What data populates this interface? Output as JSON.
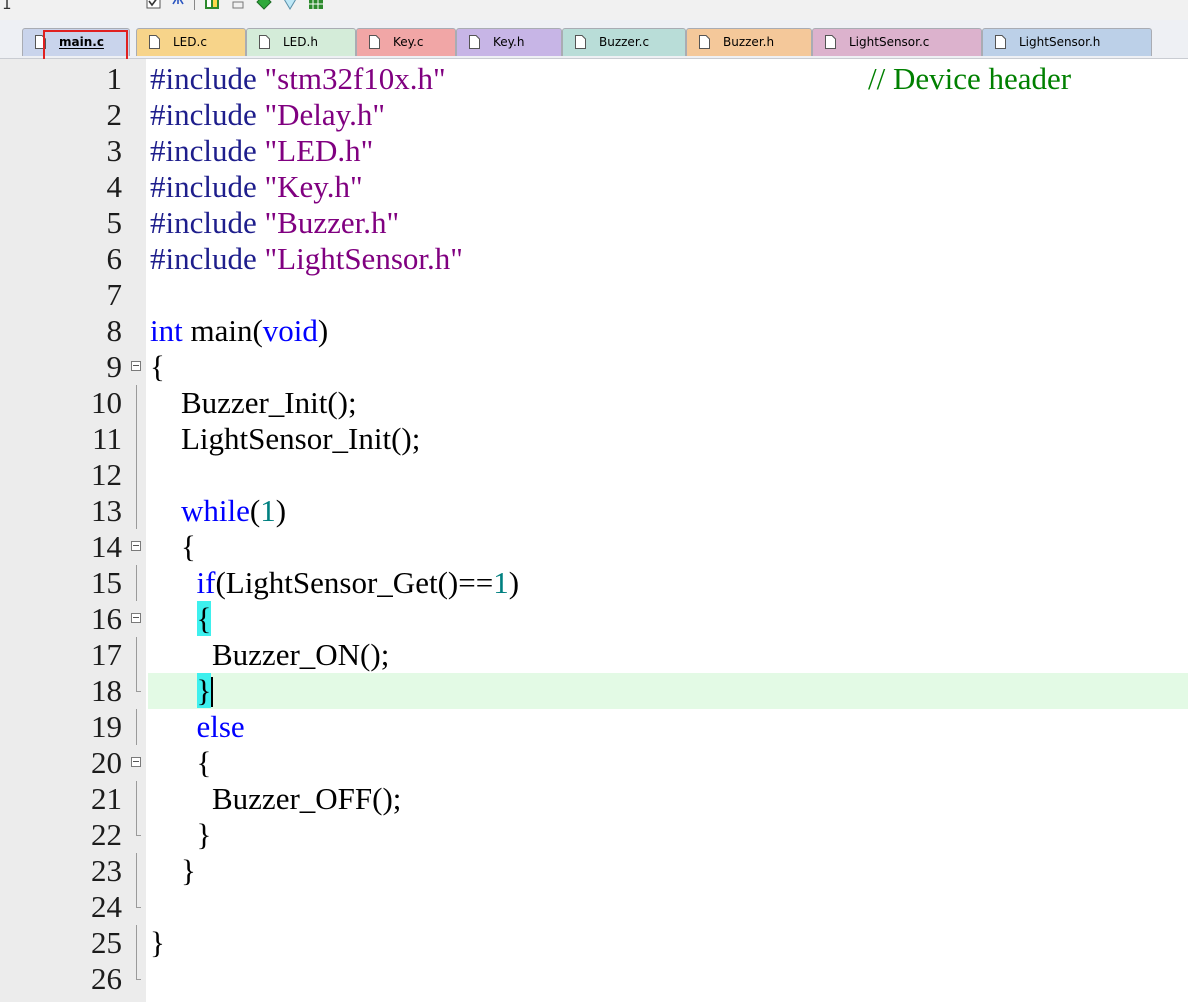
{
  "colors": {
    "keyword": "#0000ff",
    "string": "#800080",
    "comment": "#008000",
    "number": "#008080",
    "current_line_bg": "#e3fae5",
    "brace_match_bg": "#3ef0ee",
    "annotation_box": "#e02020"
  },
  "toolbar": {
    "icons": [
      "checkbox-icon",
      "tree-icon",
      "window-icon",
      "layout-icon",
      "diamond-icon",
      "gem-icon",
      "grid-icon"
    ]
  },
  "tabs": [
    {
      "label": "main.c",
      "color": "#c9d4ec",
      "active": true
    },
    {
      "label": "LED.c",
      "color": "#f7d48a"
    },
    {
      "label": "LED.h",
      "color": "#d4ecd9"
    },
    {
      "label": "Key.c",
      "color": "#f1a6a6"
    },
    {
      "label": "Key.h",
      "color": "#c7b5e6"
    },
    {
      "label": "Buzzer.c",
      "color": "#b9ddd8"
    },
    {
      "label": "Buzzer.h",
      "color": "#f4c89a"
    },
    {
      "label": "LightSensor.c",
      "color": "#dcb2cd"
    },
    {
      "label": "LightSensor.h",
      "color": "#bcd0e8"
    }
  ],
  "editor": {
    "current_line": 18,
    "lines": [
      {
        "n": "1",
        "tokens": [
          [
            "pp",
            "#include "
          ],
          [
            "str",
            "\"stm32f10x.h\""
          ]
        ],
        "comment": "// Device header"
      },
      {
        "n": "2",
        "tokens": [
          [
            "pp",
            "#include "
          ],
          [
            "str",
            "\"Delay.h\""
          ]
        ]
      },
      {
        "n": "3",
        "tokens": [
          [
            "pp",
            "#include "
          ],
          [
            "str",
            "\"LED.h\""
          ]
        ]
      },
      {
        "n": "4",
        "tokens": [
          [
            "pp",
            "#include "
          ],
          [
            "str",
            "\"Key.h\""
          ]
        ]
      },
      {
        "n": "5",
        "tokens": [
          [
            "pp",
            "#include "
          ],
          [
            "str",
            "\"Buzzer.h\""
          ]
        ]
      },
      {
        "n": "6",
        "tokens": [
          [
            "pp",
            "#include "
          ],
          [
            "str",
            "\"LightSensor.h\""
          ]
        ]
      },
      {
        "n": "7",
        "tokens": []
      },
      {
        "n": "8",
        "tokens": [
          [
            "kw",
            "int"
          ],
          [
            "id",
            " main("
          ],
          [
            "kw",
            "void"
          ],
          [
            "id",
            ")"
          ]
        ]
      },
      {
        "n": "9",
        "fold": "open",
        "tokens": [
          [
            "id",
            "{"
          ]
        ]
      },
      {
        "n": "10",
        "fold": "line",
        "tokens": [
          [
            "id",
            "    Buzzer_Init();"
          ]
        ]
      },
      {
        "n": "11",
        "fold": "line",
        "tokens": [
          [
            "id",
            "    LightSensor_Init();"
          ]
        ]
      },
      {
        "n": "12",
        "fold": "line",
        "tokens": []
      },
      {
        "n": "13",
        "fold": "line",
        "tokens": [
          [
            "id",
            "    "
          ],
          [
            "kw",
            "while"
          ],
          [
            "id",
            "("
          ],
          [
            "num",
            "1"
          ],
          [
            "id",
            ")"
          ]
        ]
      },
      {
        "n": "14",
        "fold": "open",
        "tokens": [
          [
            "id",
            "    {"
          ]
        ]
      },
      {
        "n": "15",
        "fold": "line",
        "tokens": [
          [
            "id",
            "      "
          ],
          [
            "kw",
            "if"
          ],
          [
            "id",
            "(LightSensor_Get()=="
          ],
          [
            "num",
            "1"
          ],
          [
            "id",
            ")"
          ]
        ]
      },
      {
        "n": "16",
        "fold": "open",
        "tokens": [
          [
            "id",
            "      "
          ],
          [
            "match",
            "{"
          ]
        ]
      },
      {
        "n": "17",
        "fold": "line",
        "tokens": [
          [
            "id",
            "        Buzzer_ON();"
          ]
        ]
      },
      {
        "n": "18",
        "fold": "end",
        "tokens": [
          [
            "id",
            "      "
          ],
          [
            "match",
            "}"
          ],
          [
            "caret",
            ""
          ]
        ]
      },
      {
        "n": "19",
        "fold": "line",
        "tokens": [
          [
            "id",
            "      "
          ],
          [
            "kw",
            "else"
          ]
        ]
      },
      {
        "n": "20",
        "fold": "open",
        "tokens": [
          [
            "id",
            "      {"
          ]
        ]
      },
      {
        "n": "21",
        "fold": "line",
        "tokens": [
          [
            "id",
            "        Buzzer_OFF();"
          ]
        ]
      },
      {
        "n": "22",
        "fold": "end",
        "tokens": [
          [
            "id",
            "      }"
          ]
        ]
      },
      {
        "n": "23",
        "fold": "line",
        "tokens": [
          [
            "id",
            "    }"
          ]
        ]
      },
      {
        "n": "24",
        "fold": "end",
        "tokens": []
      },
      {
        "n": "25",
        "fold": "line",
        "tokens": [
          [
            "id",
            "}"
          ]
        ]
      },
      {
        "n": "26",
        "fold": "end",
        "tokens": []
      }
    ]
  }
}
